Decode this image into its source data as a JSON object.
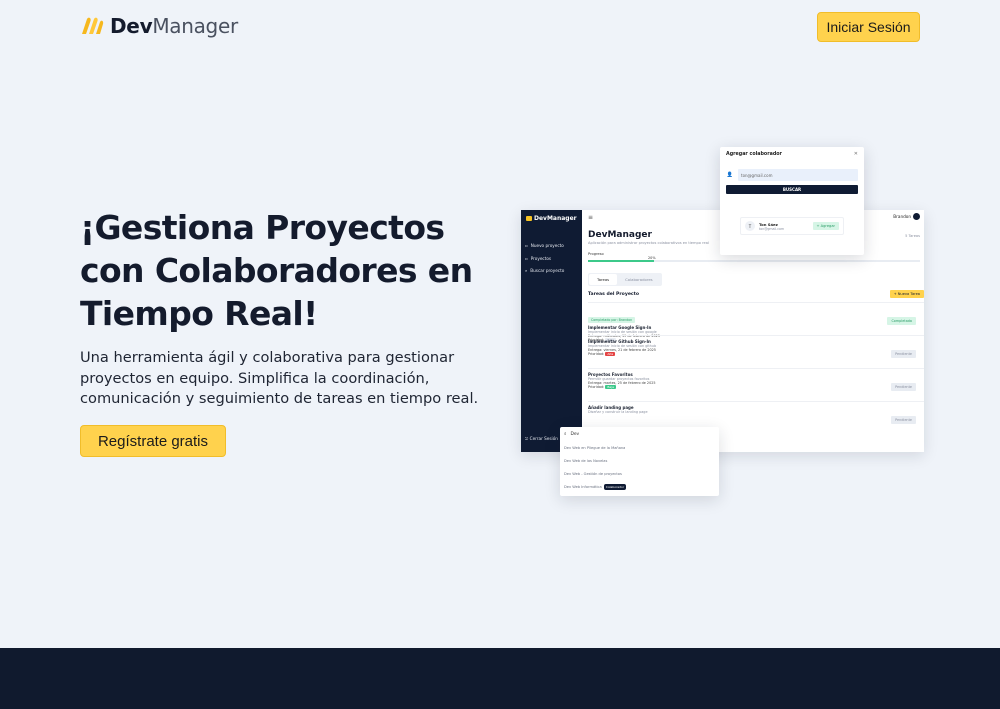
{
  "brand": {
    "name_bold": "Dev",
    "name_light": "Manager"
  },
  "nav": {
    "login_label": "Iniciar Sesión"
  },
  "hero": {
    "title": "¡Gestiona Proyectos con Colaboradores en Tiempo Real!",
    "subtitle": "Una herramienta ágil y colaborativa para gestionar proyectos en equipo. Simplifica la coordinación, comunicación y seguimiento de tareas en tiempo real.",
    "cta_label": "Regístrate gratis"
  },
  "colors": {
    "accent": "#ffd24d",
    "dark": "#0f1b33",
    "background": "#eff3f9",
    "success": "#3cc98a",
    "danger": "#e44343"
  },
  "mockup": {
    "sidebar": {
      "logo": "DevManager",
      "items": [
        {
          "icon": "plus-icon",
          "label": "Nuevo proyecto"
        },
        {
          "icon": "folder-icon",
          "label": "Proyectos"
        },
        {
          "icon": "search-icon",
          "label": "Buscar proyecto"
        }
      ],
      "logout": "Cerrar Sesión"
    },
    "user": "Brandon",
    "project_title": "DevManager",
    "project_desc": "Aplicación para administrar proyectos colaborativos en tiempo real",
    "task_count": "5 Tareas",
    "progress_label": "Progreso",
    "progress_value": 20,
    "progress_pct": "20%",
    "tabs": [
      "Tareas",
      "Colaboradores"
    ],
    "section_title": "Tareas del Proyecto",
    "new_task_label": "+ Nueva Tarea",
    "tasks": [
      {
        "chip": "Completado por: Brandon",
        "title": "Implementar Google Sign-In",
        "desc": "Implementar inicio de sesión con google",
        "due": "Entrega: miércoles, 19 de febrero de 2025",
        "priority_label": "Prioridad:",
        "priority": "Baja",
        "status": "Completada"
      },
      {
        "chip": "",
        "title": "Implementar Github Sign-In",
        "desc": "Implementar inicio de sesión con github",
        "due": "Entrega: viernes, 21 de febrero de 2025",
        "priority_label": "Prioridad:",
        "priority": "Alta",
        "status": "Pendiente"
      },
      {
        "chip": "",
        "title": "Proyectos Favoritos",
        "desc": "Permitir guardar proyectos favoritos",
        "due": "Entrega: martes, 25 de febrero de 2025",
        "priority_label": "Prioridad:",
        "priority": "Baja",
        "status": "Pendiente"
      },
      {
        "chip": "",
        "title": "Añadir landing page",
        "desc": "Diseñar y construir la landing page",
        "due": "",
        "priority_label": "",
        "priority": "",
        "status": "Pendiente"
      }
    ]
  },
  "modal": {
    "title": "Agregar colaborador",
    "email": "ton@gmail.com",
    "button": "BUSCAR",
    "result_initial": "T",
    "result_name": "Ton Sáez",
    "result_email": "ton@gmail.com",
    "add_label": "+ Agregar"
  },
  "search_dropdown": {
    "query": "Dev",
    "items": [
      {
        "label": "Dev Web en Pliegue de la Mañana",
        "badge": ""
      },
      {
        "label": "Dev Web de las Novelas",
        "badge": ""
      },
      {
        "label": "Dev Web - Gestión de proyectos",
        "badge": ""
      },
      {
        "label": "Dev Web Informática",
        "badge": "Colaborador"
      }
    ]
  }
}
